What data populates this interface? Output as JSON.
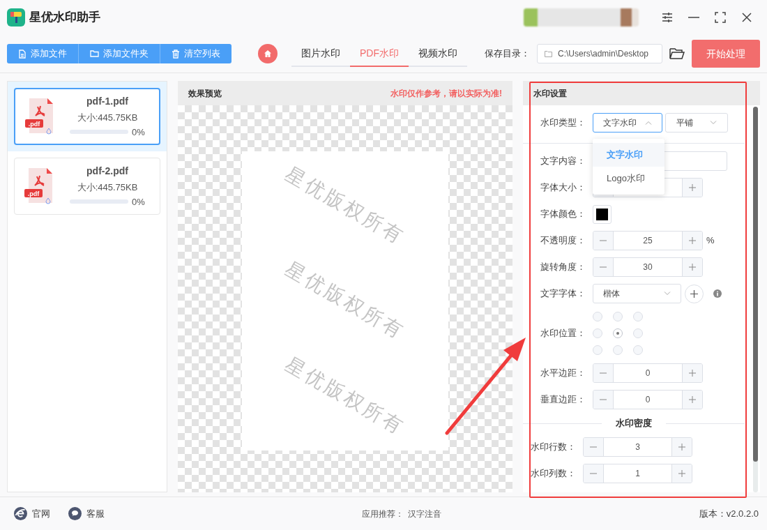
{
  "app": {
    "title": "星优水印助手"
  },
  "toolbar": {
    "buttons": [
      {
        "kind": "file",
        "label": "添加文件"
      },
      {
        "kind": "folder",
        "label": "添加文件夹"
      },
      {
        "kind": "trash",
        "label": "清空列表"
      }
    ]
  },
  "tabs": [
    {
      "label": "图片水印",
      "selected": false
    },
    {
      "label": "PDF水印",
      "selected": true
    },
    {
      "label": "视频水印",
      "selected": false
    }
  ],
  "save_dir": {
    "label": "保存目录：",
    "value": "C:\\Users\\admin\\Desktop"
  },
  "start_button": "开始处理",
  "files": [
    {
      "badge": ".pdf",
      "name": "pdf-1.pdf",
      "size": "大小:445.75KB",
      "progress": "0%",
      "level": 0,
      "selected": true
    },
    {
      "badge": ".pdf",
      "name": "pdf-2.pdf",
      "size": "大小:445.75KB",
      "progress": "0%",
      "level": 0,
      "selected": false
    }
  ],
  "preview": {
    "title": "效果预览",
    "notice": "水印仅作参考，请以实际为准!",
    "watermarks": [
      "星优版权所有",
      "星优版权所有",
      "星优版权所有"
    ]
  },
  "settings": {
    "title": "水印设置",
    "type_select": {
      "label": "水印类型：",
      "value": "文字水印",
      "expanded": true,
      "options": [
        {
          "label": "文字水印",
          "selected": true
        },
        {
          "label": "Logo水印",
          "selected": false
        }
      ]
    },
    "mode_select": {
      "value": "平铺"
    },
    "rows": [
      {
        "kind": "text",
        "label": "文字内容："
      },
      {
        "kind": "stepper",
        "label": "字体大小："
      },
      {
        "kind": "color",
        "label": "字体颜色：",
        "color": "#000000"
      },
      {
        "kind": "stepper",
        "label": "不透明度：",
        "value": "25",
        "unit": "%"
      },
      {
        "kind": "stepper",
        "label": "旋转角度：",
        "value": "30"
      },
      {
        "kind": "font",
        "label": "文字字体：",
        "value": "楷体"
      },
      {
        "kind": "position",
        "label": "水印位置：",
        "cells": [
          {
            "selected": false
          },
          {
            "selected": false
          },
          {
            "selected": false
          },
          {
            "selected": false
          },
          {
            "selected": true
          },
          {
            "selected": false
          },
          {
            "selected": false
          },
          {
            "selected": false
          },
          {
            "selected": false
          }
        ]
      },
      {
        "kind": "stepper",
        "label": "水平边距：",
        "value": "0"
      },
      {
        "kind": "stepper",
        "label": "垂直边距：",
        "value": "0"
      },
      {
        "kind": "section",
        "label": "水印密度",
        "rows": [
          {
            "kind": "stepper",
            "label": "水印行数：",
            "value": "3"
          },
          {
            "kind": "stepper",
            "label": "水印列数：",
            "value": "1"
          }
        ]
      }
    ]
  },
  "footer": {
    "links": [
      {
        "kind": "web",
        "label": "官网"
      },
      {
        "kind": "chat",
        "label": "客服"
      }
    ],
    "recommend_label": "应用推荐：",
    "recommend": "汉字注音",
    "version": "版本：v2.0.2.0"
  }
}
